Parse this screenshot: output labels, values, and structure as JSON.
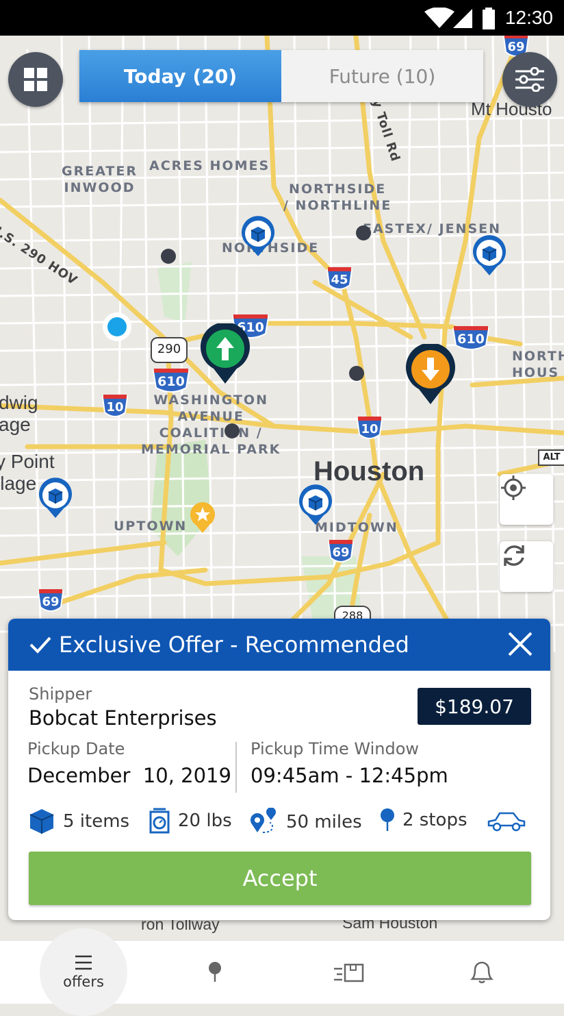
{
  "status_bar": {
    "time": "12:30"
  },
  "tabs": [
    {
      "label": "Today (20)",
      "active": true
    },
    {
      "label": "Future (10)",
      "active": false
    }
  ],
  "map": {
    "city_label": "Houston",
    "area_labels": [
      {
        "key": "greater_inwood",
        "text": "GREATER\nINWOOD"
      },
      {
        "key": "acres_homes",
        "text": "ACRES HOMES"
      },
      {
        "key": "northside_northline",
        "text": "NORTHSIDE\n/ NORTHLINE"
      },
      {
        "key": "eastex",
        "text": "EASTEX/ JENSEN"
      },
      {
        "key": "northside",
        "text": "NORTHSIDE"
      },
      {
        "key": "washington",
        "text": "WASHINGTON\nAVENUE\nCOALITION /\nMEMORIAL PARK"
      },
      {
        "key": "uptown",
        "text": "UPTOWN"
      },
      {
        "key": "midtown",
        "text": "MIDTOWN"
      }
    ],
    "edge_labels": {
      "mt_houston": "Mt Housto",
      "north_hous": "NORTH\nHOUS",
      "dwig": "dwig\nage",
      "point": "y Point\nllage",
      "us290": "U.S. 290 HOV",
      "tollrd": "y Toll Rd",
      "tollway": "ron Tollway",
      "sam_houston": "Sam Houston"
    },
    "shields": {
      "i610_a": "610",
      "i610_b": "610",
      "i610_c": "610",
      "i10_a": "10",
      "i10_b": "10",
      "i45": "45",
      "i69_a": "69",
      "i69_b": "69",
      "i69_c": "69",
      "us290": "290",
      "sh288": "288",
      "alt": "ALT"
    }
  },
  "offer": {
    "header": "Exclusive Offer - Recommended",
    "shipper_label": "Shipper",
    "shipper_name": "Bobcat Enterprises",
    "price": "$189.07",
    "pickup_date_label": "Pickup Date",
    "pickup_date": "December  10, 2019",
    "pickup_window_label": "Pickup Time Window",
    "pickup_window": "09:45am - 12:45pm",
    "items": "5 items",
    "weight": "20 lbs",
    "distance": "50 miles",
    "stops": "2 stops",
    "accept_label": "Accept"
  },
  "bottom_nav": [
    {
      "key": "offers",
      "label": "offers",
      "icon": "list-icon",
      "active": true
    },
    {
      "key": "map",
      "label": "",
      "icon": "pin-icon",
      "active": false
    },
    {
      "key": "deliveries",
      "label": "",
      "icon": "delivery-icon",
      "active": false
    },
    {
      "key": "notifications",
      "label": "",
      "icon": "bell-icon",
      "active": false
    }
  ],
  "colors": {
    "primary": "#0f56b3",
    "accept": "#7dbb55",
    "price_bg": "#0a1f3c",
    "pickup_marker": "#1aa95a",
    "dropoff_marker": "#f39a1a"
  }
}
